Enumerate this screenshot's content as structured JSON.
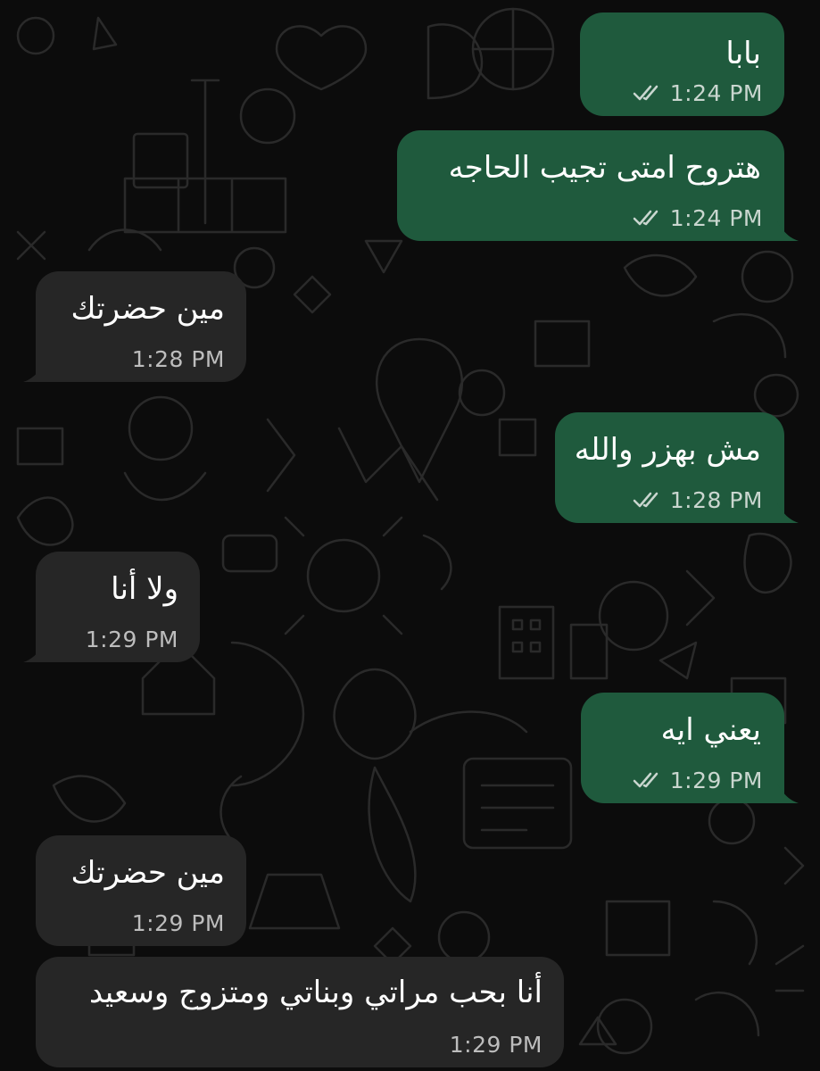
{
  "chat": {
    "messages": [
      {
        "direction": "outgoing",
        "text": "بابا",
        "time": "1:24 PM",
        "ticks": "double-check-icon"
      },
      {
        "direction": "outgoing",
        "text": "هتروح امتى تجيب الحاجه",
        "time": "1:24 PM",
        "ticks": "double-check-icon"
      },
      {
        "direction": "incoming",
        "text": "مين حضرتك",
        "time": "1:28 PM"
      },
      {
        "direction": "outgoing",
        "text": "مش بهزر والله",
        "time": "1:28 PM",
        "ticks": "double-check-icon"
      },
      {
        "direction": "incoming",
        "text": "ولا أنا",
        "time": "1:29 PM"
      },
      {
        "direction": "outgoing",
        "text": "يعني ايه",
        "time": "1:29 PM",
        "ticks": "double-check-icon"
      },
      {
        "direction": "incoming",
        "text": "مين حضرتك",
        "time": "1:29 PM"
      },
      {
        "direction": "incoming",
        "text": "أنا بحب مراتي وبناتي ومتزوج وسعيد",
        "time": "1:29 PM"
      }
    ]
  },
  "colors": {
    "outgoing_bubble": "#1f5a3d",
    "incoming_bubble": "#262626",
    "background": "#0c0c0c"
  }
}
